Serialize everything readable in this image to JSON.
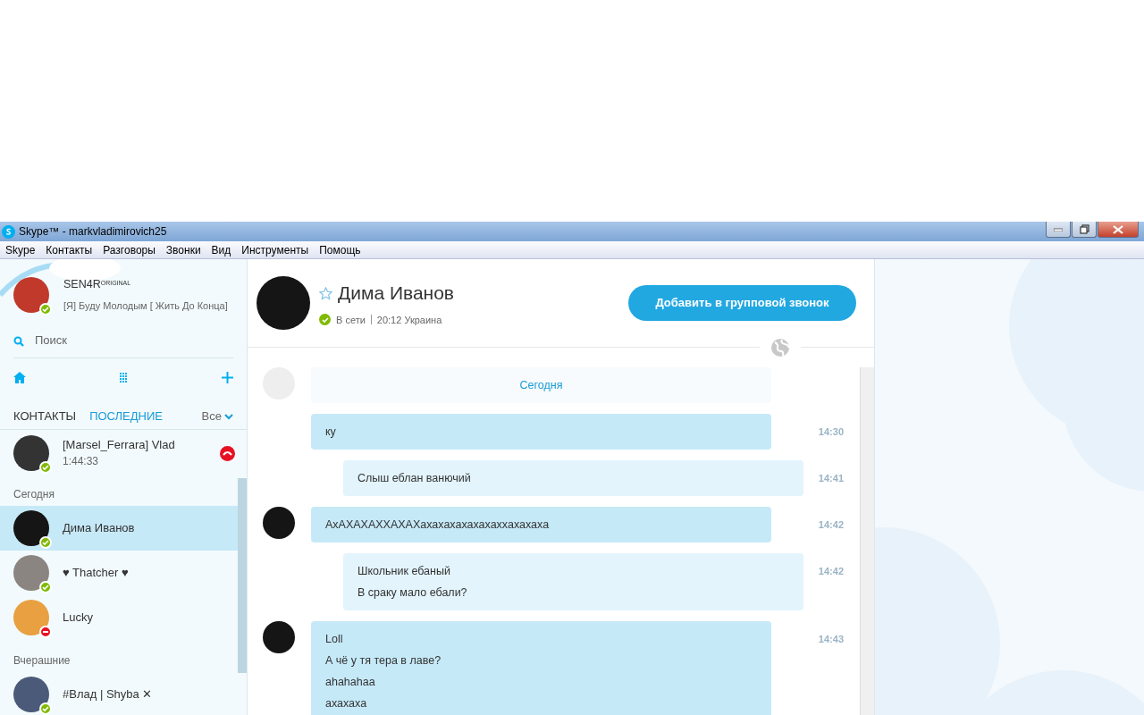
{
  "window": {
    "title": "Skype™ - markvladimirovich25"
  },
  "menu": [
    "Skype",
    "Контакты",
    "Разговоры",
    "Звонки",
    "Вид",
    "Инструменты",
    "Помощь"
  ],
  "profile": {
    "name": "SEN4R",
    "name_suffix": "ORIGINAL",
    "mood": "[Я] Буду Молодым [ Жить До Конца]",
    "color": "#7fba00"
  },
  "search": {
    "placeholder": "Поиск"
  },
  "tabs": [
    {
      "label": "КОНТАКТЫ",
      "selected": false
    },
    {
      "label": "ПОСЛЕДНИЕ",
      "selected": true
    }
  ],
  "filter": {
    "label": "Все"
  },
  "recents": [
    {
      "kind": "call",
      "name": "[Marsel_Ferrara] Vlad",
      "duration": "1:44:33",
      "color": "#7fba00",
      "selected": false
    },
    {
      "kind": "header",
      "label": "Сегодня"
    },
    {
      "kind": "contact",
      "name": "Дима Иванов",
      "color": "#7fba00",
      "selected": true
    },
    {
      "kind": "contact",
      "name": "♥ Thatcher ♥",
      "color": "#7fba00",
      "selected": false
    },
    {
      "kind": "contact",
      "name": "Lucky",
      "color": "#e81123",
      "selected": false
    },
    {
      "kind": "header",
      "label": "Вчерашние"
    },
    {
      "kind": "contact",
      "name": "#Влад | Shyba ✕",
      "color": "#7fba00",
      "selected": false
    }
  ],
  "chat": {
    "name": "Дима Иванов",
    "color": "#7fba00",
    "status_text": "В сети",
    "local_time": "20:12 Украина",
    "favorite": false,
    "call_button": "Добавить в групповой звонок",
    "date_banner": "Сегодня",
    "messages": [
      {
        "kind": "received",
        "avatar": false,
        "lines": [
          "ку"
        ],
        "time": "14:30"
      },
      {
        "kind": "sent",
        "avatar": false,
        "lines": [
          "Слыш еблан ванючий"
        ],
        "time": "14:41"
      },
      {
        "kind": "received",
        "avatar": true,
        "lines": [
          "АхАХАХАХХАХАХахахахахахахаххахахаха"
        ],
        "time": "14:42"
      },
      {
        "kind": "sent",
        "avatar": false,
        "lines": [
          "Школьник ебаный",
          "В сраку мало ебали?"
        ],
        "time": "14:42"
      },
      {
        "kind": "received",
        "avatar": true,
        "lines": [
          "Loll",
          "А чё у тя тера в лаве?",
          "ahahahaa",
          "ахахаха"
        ],
        "time": "14:43"
      }
    ]
  }
}
